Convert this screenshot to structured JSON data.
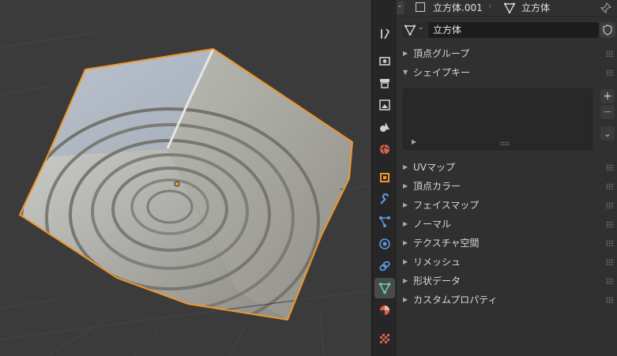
{
  "header": {
    "object_name": "立方体.001",
    "mesh_name": "立方体"
  },
  "datablock": {
    "name": "立方体"
  },
  "panels": [
    {
      "label": "頂点グループ",
      "expanded": false
    },
    {
      "label": "シェイプキー",
      "expanded": true
    },
    {
      "label": "UVマップ",
      "expanded": false
    },
    {
      "label": "頂点カラー",
      "expanded": false
    },
    {
      "label": "フェイスマップ",
      "expanded": false
    },
    {
      "label": "ノーマル",
      "expanded": false
    },
    {
      "label": "テクスチャ空間",
      "expanded": false
    },
    {
      "label": "リメッシュ",
      "expanded": false
    },
    {
      "label": "形状データ",
      "expanded": false
    },
    {
      "label": "カスタムプロパティ",
      "expanded": false
    }
  ],
  "shape_keys": {
    "add_label": "+",
    "remove_label": "−"
  },
  "tabs": [
    {
      "icon": "tool-icon",
      "active": false
    },
    {
      "icon": "render-icon",
      "active": false
    },
    {
      "icon": "output-icon",
      "active": false
    },
    {
      "icon": "view-layer-icon",
      "active": false
    },
    {
      "icon": "scene-icon",
      "active": false
    },
    {
      "icon": "world-icon",
      "active": false
    },
    {
      "icon": "object-icon",
      "active": false
    },
    {
      "icon": "modifier-icon",
      "active": false
    },
    {
      "icon": "particles-icon",
      "active": false
    },
    {
      "icon": "physics-icon",
      "active": false
    },
    {
      "icon": "constraints-icon",
      "active": false
    },
    {
      "icon": "mesh-data-icon",
      "active": true
    },
    {
      "icon": "material-icon",
      "active": false
    },
    {
      "icon": "texture-icon",
      "active": false
    }
  ],
  "colors": {
    "selection_outline": "#f0962b",
    "origin": "#e8a02f",
    "active_tab": "#4a4a4a",
    "mesh_icon": "#5fd3a8"
  }
}
